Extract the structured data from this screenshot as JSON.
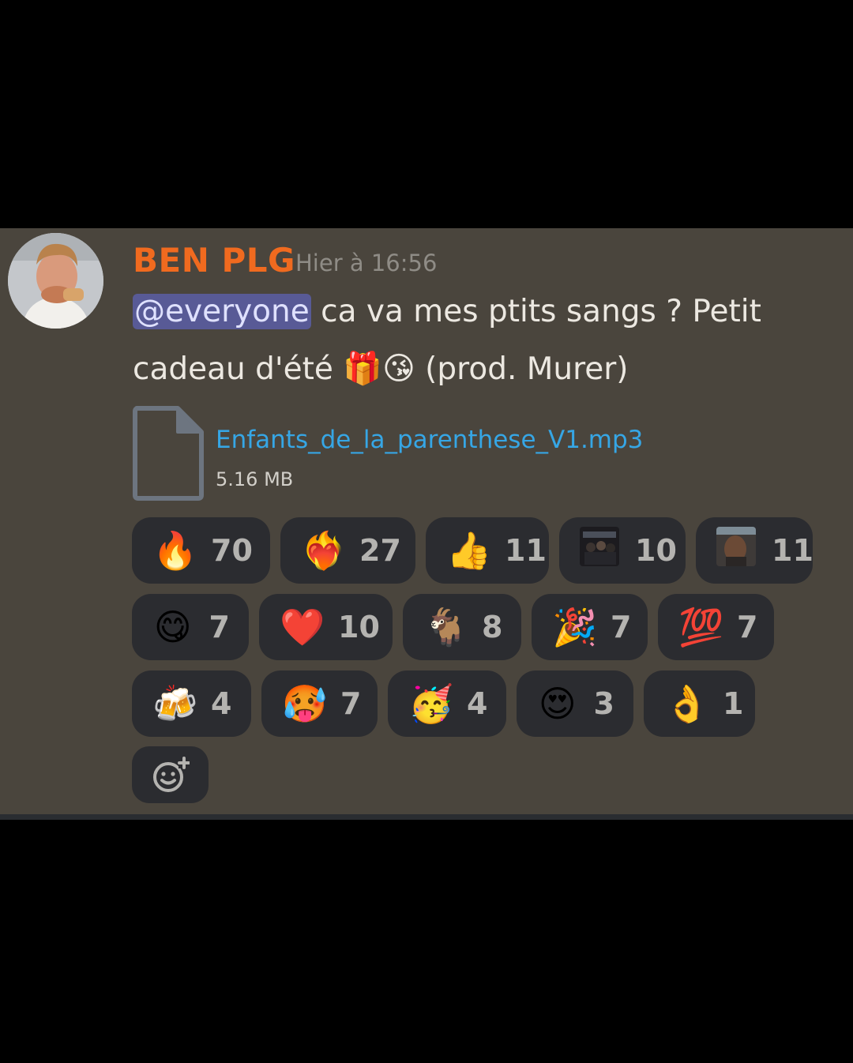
{
  "message": {
    "author": "BEN PLG",
    "author_color": "#f06a1f",
    "timestamp": "Hier à 16:56",
    "mention": "@everyone",
    "text_part1": " ca va mes ptits sangs ? Petit cadeau d'été ",
    "text_part2": " (prod. Murer)",
    "inline_emojis": [
      "🎁",
      "😘"
    ]
  },
  "attachment": {
    "icon": "file-icon",
    "file_name": "Enfants_de_la_parenthese_V1.mp3",
    "file_size": "5.16 MB",
    "link_color": "#36a6e5"
  },
  "reactions": [
    {
      "emoji": "🔥",
      "count": "70"
    },
    {
      "emoji": "❤️‍🔥",
      "count": "27"
    },
    {
      "emoji": "👍",
      "count": "11"
    },
    {
      "emoji": "custom-photo-emoji-group",
      "count": "10"
    },
    {
      "emoji": "custom-photo-emoji-face",
      "count": "11"
    },
    {
      "emoji": "😋",
      "count": "7"
    },
    {
      "emoji": "❤️",
      "count": "10"
    },
    {
      "emoji": "🐐",
      "count": "8"
    },
    {
      "emoji": "🎉",
      "count": "7"
    },
    {
      "emoji": "💯",
      "count": "7"
    },
    {
      "emoji": "🍻",
      "count": "4"
    },
    {
      "emoji": "🥵",
      "count": "7"
    },
    {
      "emoji": "🥳",
      "count": "4"
    },
    {
      "emoji": "😍",
      "count": "3"
    },
    {
      "emoji": "👌",
      "count": "1"
    }
  ],
  "add_reaction_icon": "add-reaction-icon",
  "colors": {
    "background": "#4a453d",
    "reaction_bg": "#2b2c30",
    "mention_bg": "#585a96"
  }
}
